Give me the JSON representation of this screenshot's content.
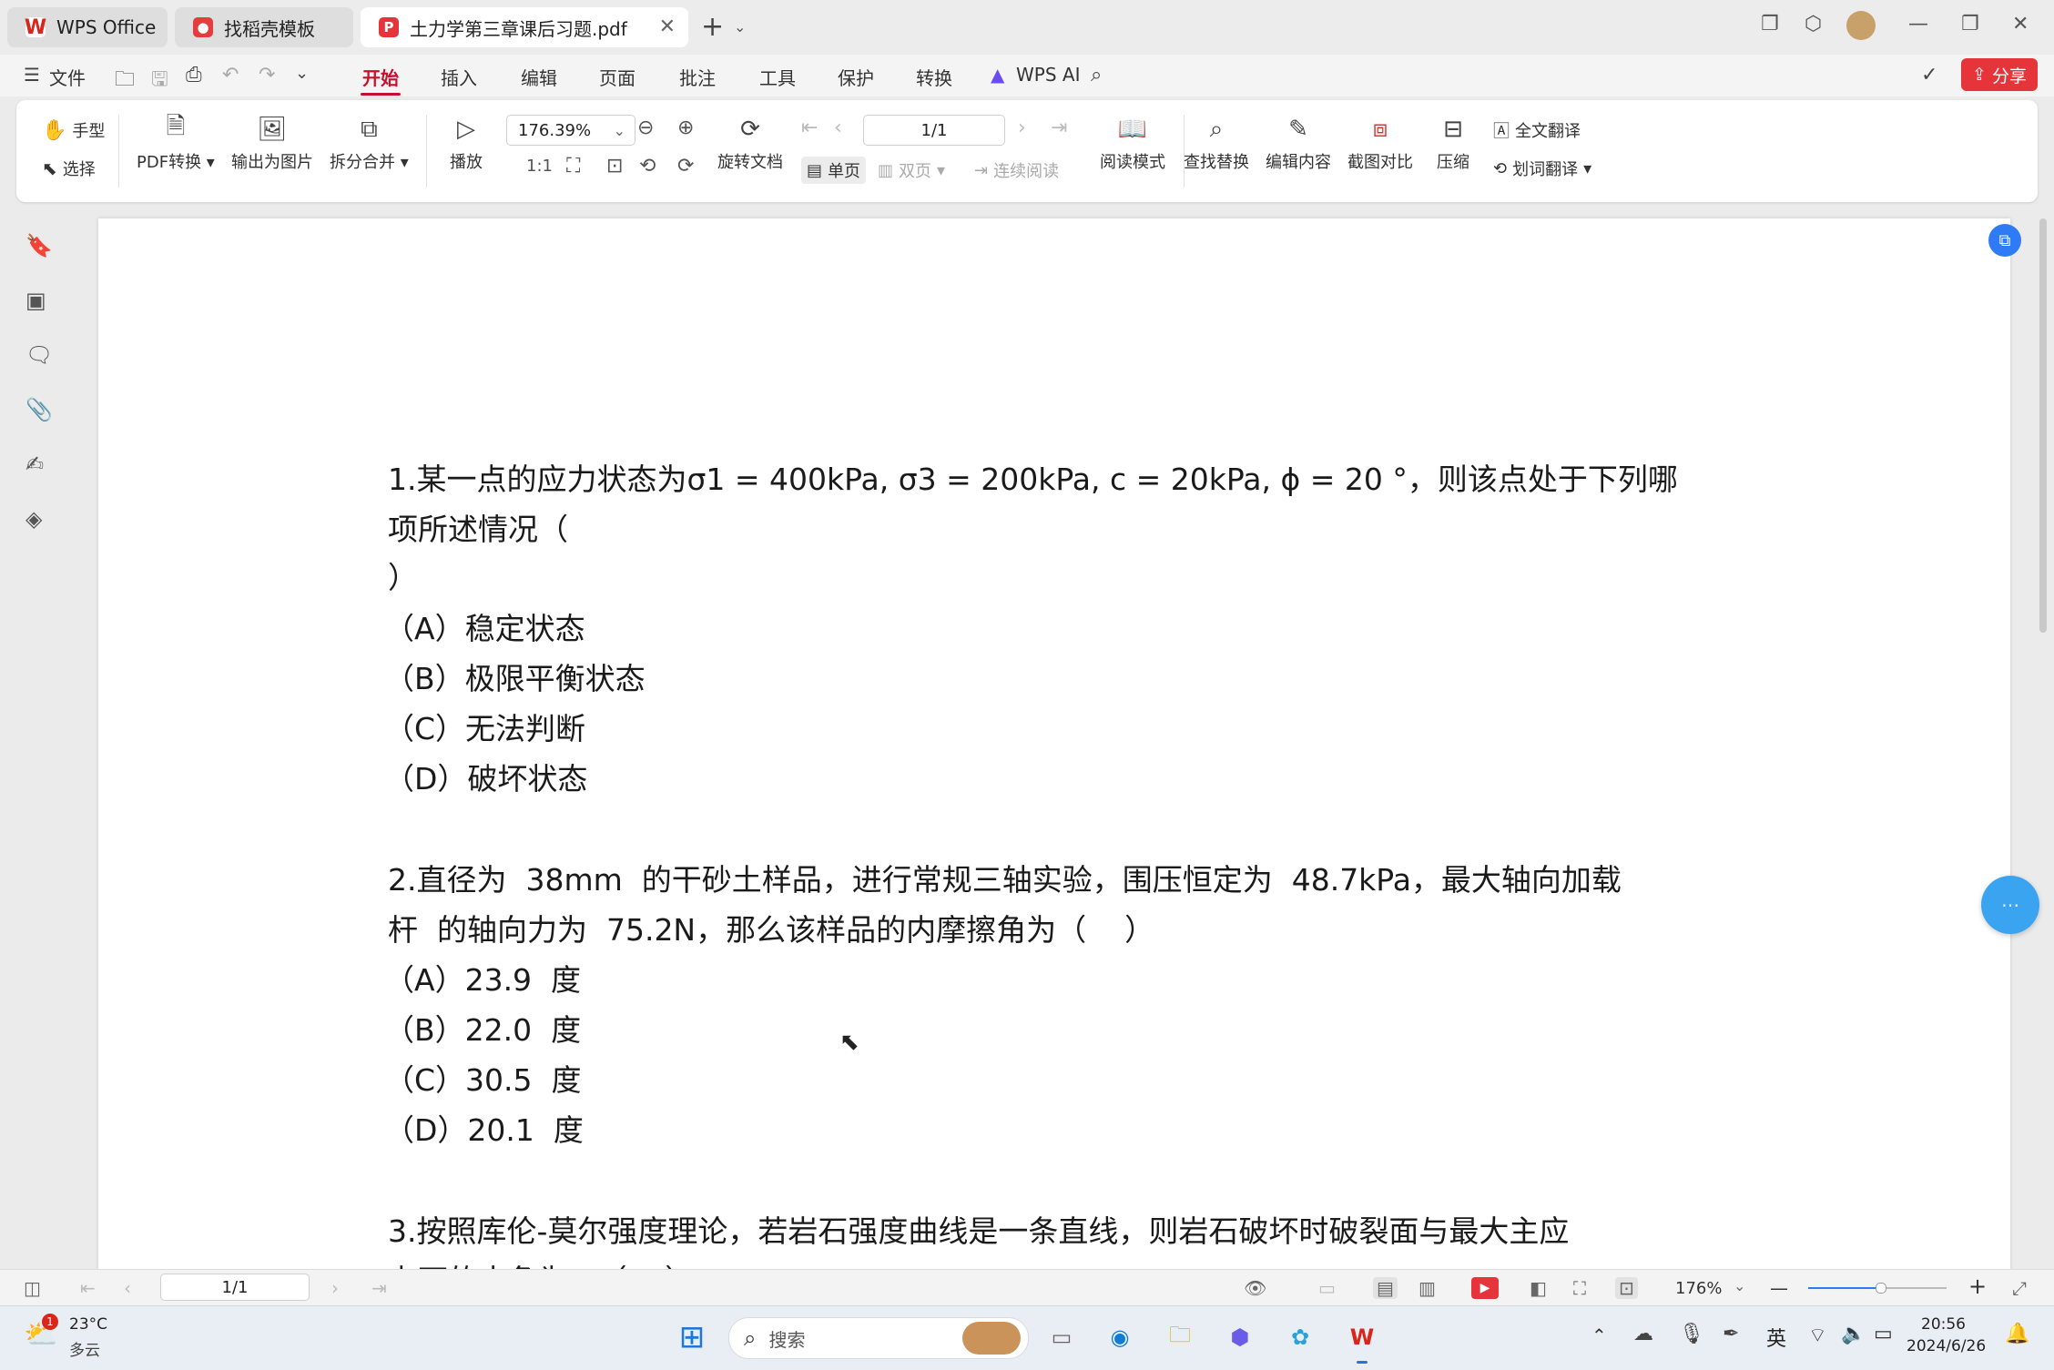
{
  "tabs": [
    {
      "label": "WPS Office"
    },
    {
      "label": "找稻壳模板"
    },
    {
      "label": "土力学第三章课后习题.pdf"
    }
  ],
  "menu": {
    "file": "文件",
    "items": [
      "开始",
      "插入",
      "编辑",
      "页面",
      "批注",
      "工具",
      "保护",
      "转换"
    ],
    "wps_ai": "WPS AI",
    "share": "分享"
  },
  "ribbon": {
    "hand": "手型",
    "select": "选择",
    "pdf_convert": "PDF转换",
    "export_image": "输出为图片",
    "split_merge": "拆分合并",
    "play": "播放",
    "zoom_value": "176.39%",
    "page_value": "1/1",
    "rotate": "旋转文档",
    "single_page": "单页",
    "double_page": "双页",
    "continuous": "连续阅读",
    "read_mode": "阅读模式",
    "find_replace": "查找替换",
    "edit_content": "编辑内容",
    "screenshot_compare": "截图对比",
    "compress": "压缩",
    "full_translate": "全文翻译",
    "word_translate": "划词翻译"
  },
  "document": {
    "lines": [
      "1.某一点的应力状态为σ1 = 400kPa, σ3 = 200kPa, c = 20kPa, ϕ = 20 °，则该点处于下列哪",
      "项所述情况（",
      "）",
      "（A）稳定状态",
      "（B）极限平衡状态",
      "（C）无法判断",
      "（D）破坏状态",
      "2.直径为  38mm  的干砂土样品，进行常规三轴实验，围压恒定为  48.7kPa，最大轴向加载",
      "杆  的轴向力为  75.2N，那么该样品的内摩擦角为（    ）",
      "（A）23.9  度",
      "（B）22.0  度",
      "（C）30.5  度",
      "（D）20.1  度",
      "3.按照库伦-莫尔强度理论，若岩石强度曲线是一条直线，则岩石破坏时破裂面与最大主应",
      "力面的夹角为   （    ）"
    ]
  },
  "statusbar": {
    "page_value": "1/1",
    "zoom": "176%"
  },
  "taskbar": {
    "weather_temp": "23°C",
    "weather_desc": "多云",
    "weather_badge": "1",
    "search_placeholder": "搜索",
    "ime": "英",
    "time": "20:56",
    "date": "2024/6/26"
  }
}
